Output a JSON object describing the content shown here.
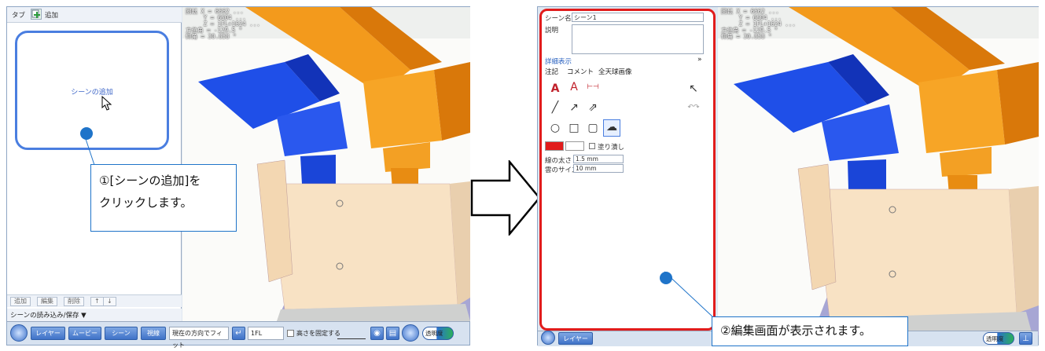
{
  "left_window": {
    "panel": {
      "tab_label": "タブ",
      "add_tab_label": "追加",
      "scene_card_label": "シーンの追加",
      "bottom_buttons": [
        "追加",
        "編集",
        "削除",
        "↑",
        "↓"
      ],
      "load_save_label": "シーンの読み込み/保存 ▼"
    },
    "coords": "回転 X = 6662 ...\n     Y = 6604 ...\n     Z = 1FL+1624 ...\n方位角 = -129.5 °\n仰角 = 30.858 °",
    "toolbar": {
      "layer": "レイヤー",
      "movie": "ムービー",
      "scene": "シーン",
      "view": "視線",
      "fit_select": "現在の方向でフィット",
      "floor_select": "1FL",
      "fix_height": "高さを固定する",
      "transparency": "透明度"
    }
  },
  "callout1": {
    "line1": "①[シーンの追加]を",
    "line2": "クリックします。"
  },
  "right_window": {
    "edit_panel": {
      "scene_name_label": "シーン名",
      "scene_name_value": "シーン1",
      "description_label": "説明",
      "details_label": "詳細表示",
      "tabs": [
        "注記",
        "コメント",
        "全天球画像"
      ],
      "fill_label": "塗り潰し",
      "line_width_label": "線の太さ",
      "line_width_value": "1.5 mm",
      "cloud_size_label": "雲のサイズ",
      "cloud_size_value": "10 mm"
    },
    "coords": "回転 X = 6662 ...\n     Y = 6604 ...\n     Z = 1FL+1624 ...\n方位角 = -129.5 °\n仰角 = 30.858 °",
    "toolbar": {
      "layer": "レイヤー",
      "transparency": "透明度"
    }
  },
  "callout2": {
    "text": "②編集画面が表示されます。"
  },
  "colors": {
    "highlight_border": "#e11c1c",
    "accent_blue": "#1f74c9",
    "duct_blue": "#1746e0",
    "duct_orange": "#f08a00",
    "unit_beige": "#f5dcb8"
  }
}
